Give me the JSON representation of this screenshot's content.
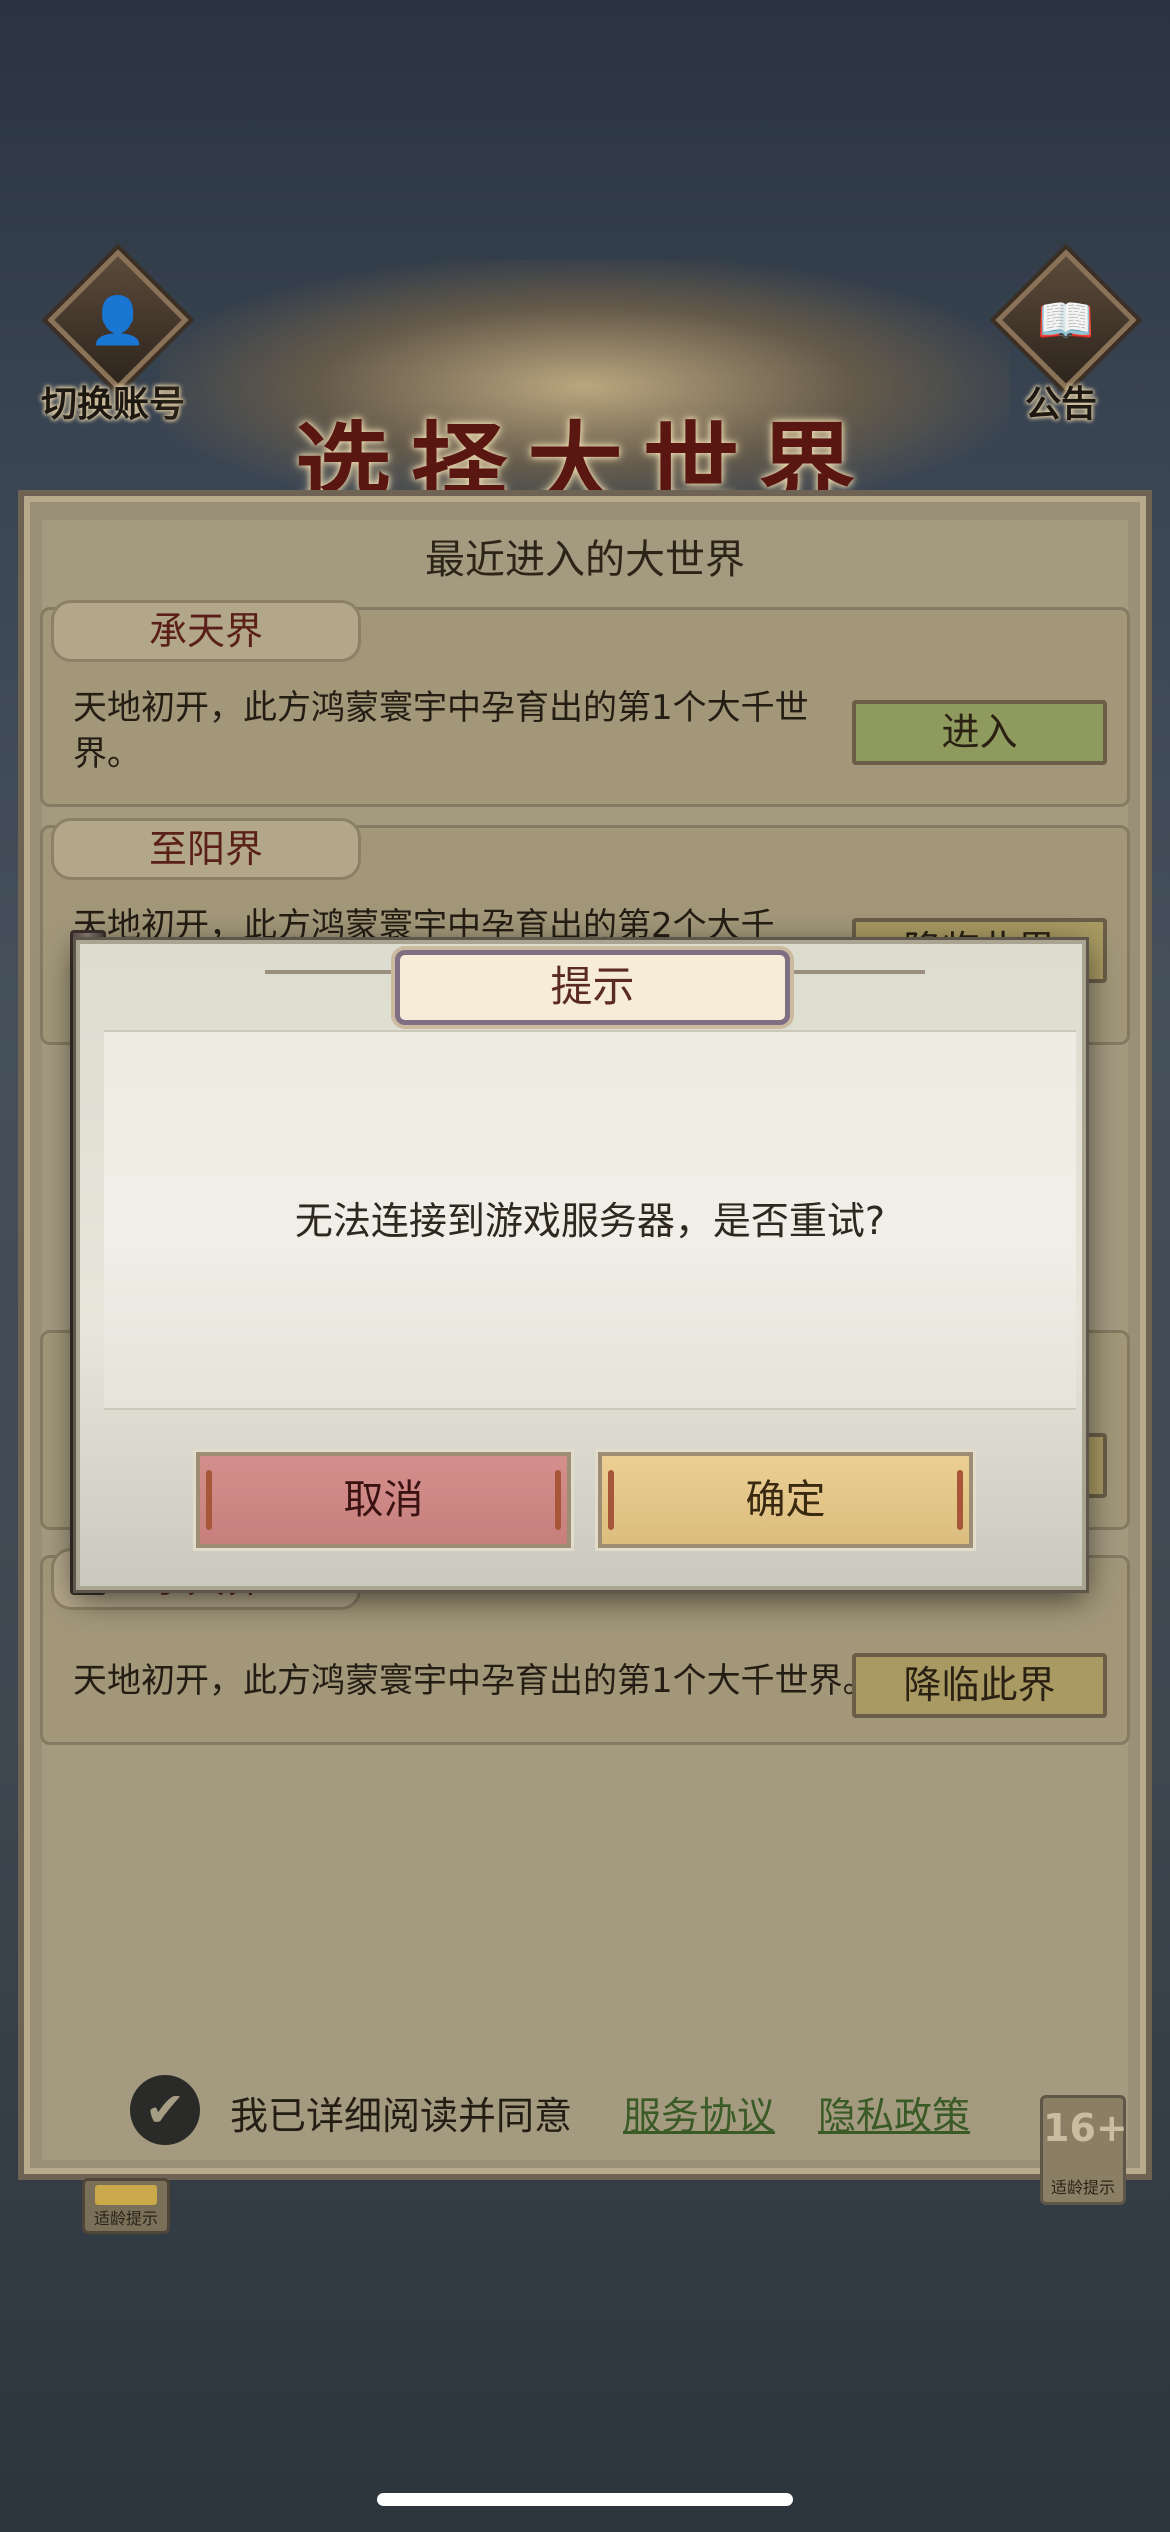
{
  "header": {
    "switch_account": "切换账号",
    "announcement": "公告",
    "title": "选择大世界"
  },
  "panel": {
    "recent_header": "最近进入的大世界",
    "worlds": [
      {
        "name": "承天界",
        "desc": "天地初开，此方鸿蒙寰宇中孕育出的第1个大千世界。",
        "button": "进入"
      },
      {
        "name": "至阳界",
        "desc": "天地初开，此方鸿蒙寰宇中孕育出的第2个大千",
        "button": "降临此界"
      },
      {
        "name": "承天界",
        "desc": "天地初开，此方鸿蒙寰宇中孕育出的第1个大千世界。",
        "button": "降临此界"
      }
    ]
  },
  "agreement": {
    "text": "我已详细阅读并同意",
    "service": "服务协议",
    "privacy": "隐私政策"
  },
  "age_rating": {
    "label": "16+",
    "caption": "适龄提示"
  },
  "dialog": {
    "title": "提示",
    "message": "无法连接到游戏服务器，是否重试?",
    "cancel": "取消",
    "confirm": "确定"
  },
  "colors": {
    "cancel_button": "#cf8a87",
    "confirm_button": "#e6c98c",
    "title_red": "#5a1712",
    "enter_button": "#8e9a5e",
    "descend_button": "#a89a62"
  }
}
